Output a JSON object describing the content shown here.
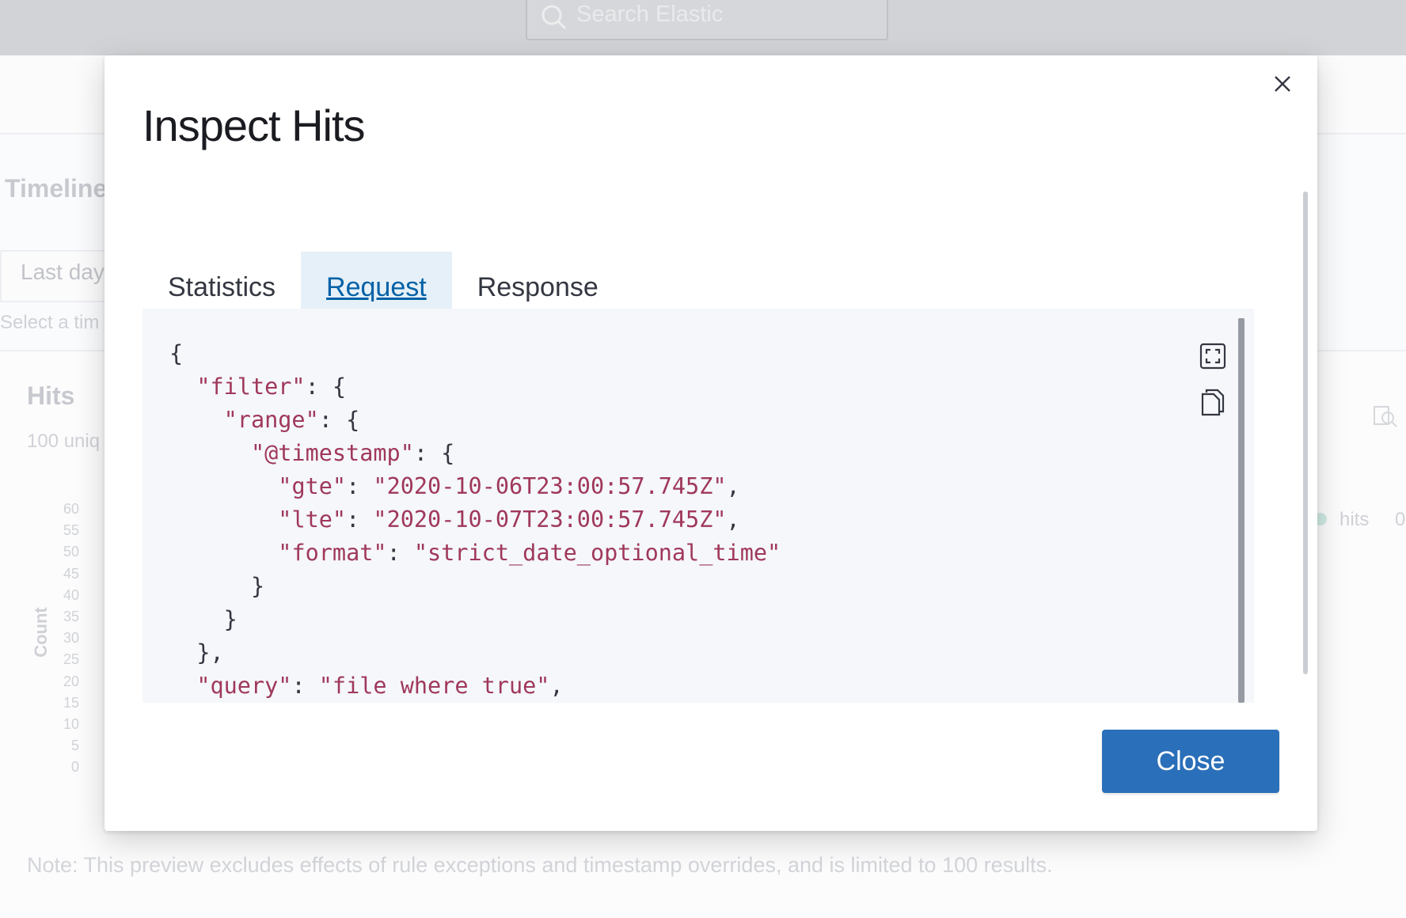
{
  "background": {
    "search_placeholder": "Search Elastic",
    "page_title": "Timeline",
    "date_range": "Last day",
    "date_hint": "Select a tim",
    "hits_title": "Hits",
    "hits_subtitle": "100 uniq",
    "y_axis_label": "Count",
    "y_ticks": [
      "60",
      "55",
      "50",
      "45",
      "40",
      "35",
      "30",
      "25",
      "20",
      "15",
      "10",
      "5",
      "0"
    ],
    "legend_label": "hits",
    "legend_value": "0",
    "note": "Note: This preview excludes effects of rule exceptions and timestamp overrides, and is limited to 100 results."
  },
  "modal": {
    "title": "Inspect Hits",
    "tabs": [
      {
        "label": "Statistics",
        "selected": false
      },
      {
        "label": "Request",
        "selected": true
      },
      {
        "label": "Response",
        "selected": false
      }
    ],
    "code_lines": [
      [
        {
          "t": "{",
          "c": "p"
        }
      ],
      [
        {
          "t": "  ",
          "c": "p"
        },
        {
          "t": "\"filter\"",
          "c": "k"
        },
        {
          "t": ": {",
          "c": "p"
        }
      ],
      [
        {
          "t": "    ",
          "c": "p"
        },
        {
          "t": "\"range\"",
          "c": "k"
        },
        {
          "t": ": {",
          "c": "p"
        }
      ],
      [
        {
          "t": "      ",
          "c": "p"
        },
        {
          "t": "\"@timestamp\"",
          "c": "k"
        },
        {
          "t": ": {",
          "c": "p"
        }
      ],
      [
        {
          "t": "        ",
          "c": "p"
        },
        {
          "t": "\"gte\"",
          "c": "k"
        },
        {
          "t": ": ",
          "c": "p"
        },
        {
          "t": "\"2020-10-06T23:00:57.745Z\"",
          "c": "s"
        },
        {
          "t": ",",
          "c": "p"
        }
      ],
      [
        {
          "t": "        ",
          "c": "p"
        },
        {
          "t": "\"lte\"",
          "c": "k"
        },
        {
          "t": ": ",
          "c": "p"
        },
        {
          "t": "\"2020-10-07T23:00:57.745Z\"",
          "c": "s"
        },
        {
          "t": ",",
          "c": "p"
        }
      ],
      [
        {
          "t": "        ",
          "c": "p"
        },
        {
          "t": "\"format\"",
          "c": "k"
        },
        {
          "t": ": ",
          "c": "p"
        },
        {
          "t": "\"strict_date_optional_time\"",
          "c": "s"
        }
      ],
      [
        {
          "t": "      }",
          "c": "p"
        }
      ],
      [
        {
          "t": "    }",
          "c": "p"
        }
      ],
      [
        {
          "t": "  },",
          "c": "p"
        }
      ],
      [
        {
          "t": "  ",
          "c": "p"
        },
        {
          "t": "\"query\"",
          "c": "k"
        },
        {
          "t": ": ",
          "c": "p"
        },
        {
          "t": "\"file where true\"",
          "c": "s"
        },
        {
          "t": ",",
          "c": "p"
        }
      ]
    ],
    "close_label": "Close",
    "icons": {
      "close": "close-icon",
      "fullscreen": "fullscreen-icon",
      "copy": "copy-icon"
    }
  }
}
